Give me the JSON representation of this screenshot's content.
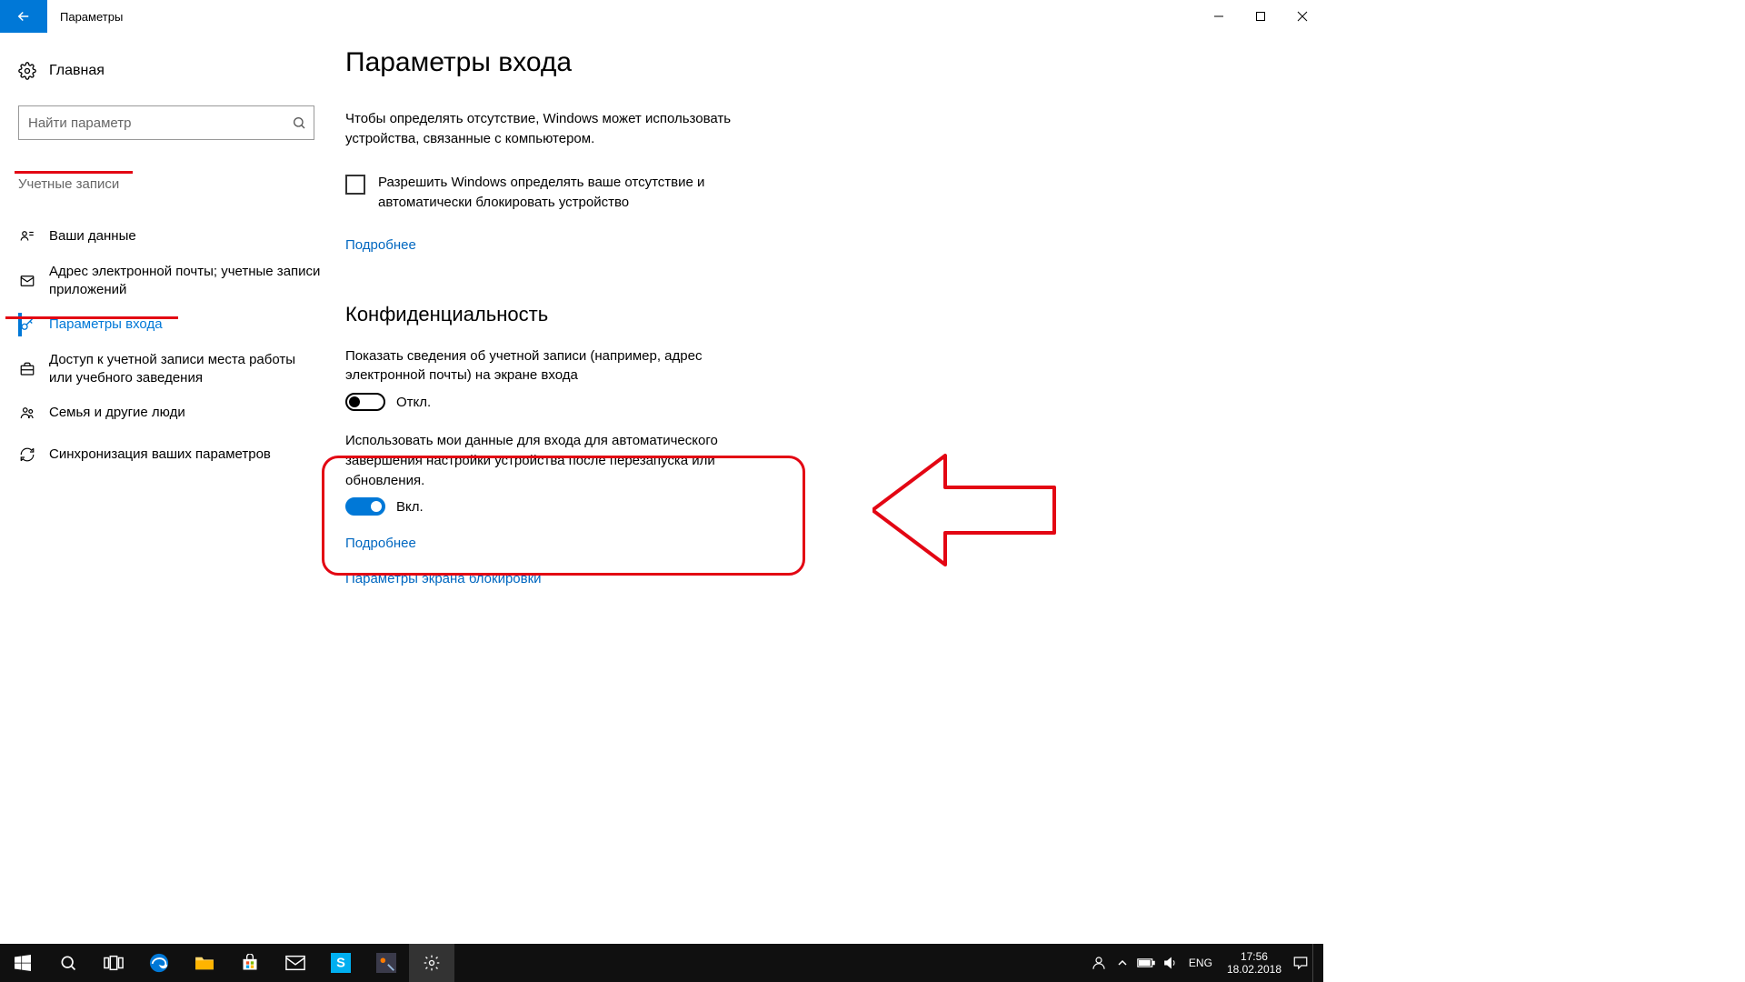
{
  "titlebar": {
    "app_title": "Параметры"
  },
  "sidebar": {
    "home": "Главная",
    "search_placeholder": "Найти параметр",
    "category": "Учетные записи",
    "items": [
      {
        "label": "Ваши данные"
      },
      {
        "label": "Адрес электронной почты; учетные записи приложений"
      },
      {
        "label": "Параметры входа"
      },
      {
        "label": "Доступ к учетной записи места работы или учебного заведения"
      },
      {
        "label": "Семья и другие люди"
      },
      {
        "label": "Синхронизация ваших параметров"
      }
    ]
  },
  "content": {
    "heading": "Параметры входа",
    "presence_desc": "Чтобы определять отсутствие, Windows может использовать устройства, связанные с компьютером.",
    "checkbox1_label": "Разрешить Windows определять ваше отсутствие и автоматически блокировать устройство",
    "learn_more": "Подробнее",
    "privacy_heading": "Конфиденциальность",
    "privacy_desc1": "Показать сведения об учетной записи (например, адрес электронной почты) на экране входа",
    "toggle1_state": "Откл.",
    "privacy_desc2": "Использовать мои данные для входа для автоматического завершения настройки устройства после перезапуска или обновления.",
    "toggle2_state": "Вкл.",
    "link_learn_more": "Подробнее",
    "link_lockscreen": "Параметры экрана блокировки"
  },
  "taskbar": {
    "lang": "ENG",
    "time": "17:56",
    "date": "18.02.2018"
  },
  "colors": {
    "accent": "#0078d7",
    "annotation_red": "#e30613"
  }
}
